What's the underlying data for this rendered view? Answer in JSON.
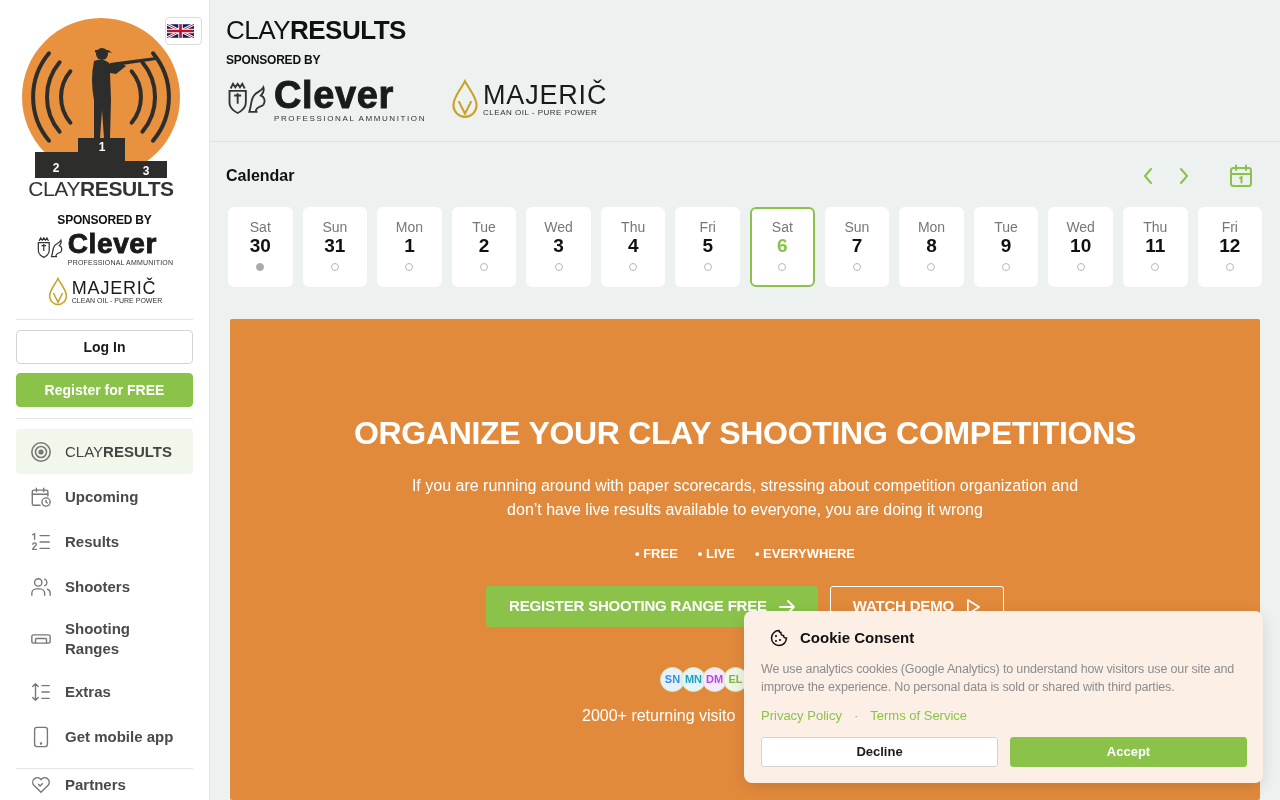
{
  "sidebar": {
    "logo": {
      "podium": [
        "2",
        "1",
        "3"
      ],
      "wordmark": "CLAY**RESULTS**"
    },
    "sponsored_label": "SPONSORED BY",
    "sponsors": [
      {
        "name": "Clever",
        "tagline": "PROFESSIONAL AMMUNITION"
      },
      {
        "name": "MAJERIČ",
        "tagline": "CLEAN OIL - PURE POWER"
      }
    ],
    "buttons": [
      {
        "label": "Log In",
        "kind": "outline"
      },
      {
        "label": "Register for FREE",
        "kind": "primary"
      }
    ],
    "nav": [
      {
        "label": "CLAY**RESULTS**",
        "kind": "brand",
        "selected": true
      },
      {
        "label": "Upcoming",
        "kind": "link",
        "selected": false
      },
      {
        "label": "Results",
        "kind": "link",
        "selected": false
      },
      {
        "label": "Shooters",
        "kind": "link",
        "selected": false
      },
      {
        "label": "Shooting Ranges",
        "kind": "link",
        "selected": false
      },
      {
        "label": "Extras",
        "kind": "link",
        "selected": false
      },
      {
        "label": "Get mobile app",
        "kind": "link",
        "selected": false
      }
    ],
    "secondary_nav": [
      {
        "label": "Partners",
        "selected": false
      }
    ]
  },
  "header": {
    "wordmark": "CLAY**RESULTS**",
    "sponsored_label": "SPONSORED BY",
    "sponsors": [
      {
        "name": "Clever",
        "tagline": "PROFESSIONAL AMMUNITION"
      },
      {
        "name": "MAJERIČ",
        "tagline": "CLEAN OIL - PURE POWER"
      }
    ]
  },
  "calendar": {
    "title": "Calendar",
    "days": [
      {
        "weekday": "Sat",
        "day": "30",
        "has_events": true,
        "selected": false
      },
      {
        "weekday": "Sun",
        "day": "31",
        "has_events": false,
        "selected": false
      },
      {
        "weekday": "Mon",
        "day": "1",
        "has_events": false,
        "selected": false
      },
      {
        "weekday": "Tue",
        "day": "2",
        "has_events": false,
        "selected": false
      },
      {
        "weekday": "Wed",
        "day": "3",
        "has_events": false,
        "selected": false
      },
      {
        "weekday": "Thu",
        "day": "4",
        "has_events": false,
        "selected": false
      },
      {
        "weekday": "Fri",
        "day": "5",
        "has_events": false,
        "selected": false
      },
      {
        "weekday": "Sat",
        "day": "6",
        "has_events": false,
        "selected": true
      },
      {
        "weekday": "Sun",
        "day": "7",
        "has_events": false,
        "selected": false
      },
      {
        "weekday": "Mon",
        "day": "8",
        "has_events": false,
        "selected": false
      },
      {
        "weekday": "Tue",
        "day": "9",
        "has_events": false,
        "selected": false
      },
      {
        "weekday": "Wed",
        "day": "10",
        "has_events": false,
        "selected": false
      },
      {
        "weekday": "Thu",
        "day": "11",
        "has_events": false,
        "selected": false
      },
      {
        "weekday": "Fri",
        "day": "12",
        "has_events": false,
        "selected": false
      }
    ]
  },
  "hero": {
    "title": "ORGANIZE YOUR CLAY SHOOTING COMPETITIONS",
    "text": "If you are running around with paper scorecards, stressing about competition organization and don’t have live results available to everyone, you are doing it wrong",
    "features": [
      "• FREE",
      "• LIVE",
      "• EVERYWHERE"
    ],
    "buttons": [
      {
        "label": "REGISTER SHOOTING RANGE FREE",
        "kind": "primary"
      },
      {
        "label": "WATCH DEMO",
        "kind": "outline"
      }
    ],
    "avatars": [
      {
        "initials": "SN",
        "color": "#3a8ee0"
      },
      {
        "initials": "MN",
        "color": "#1fa2c0"
      },
      {
        "initials": "DM",
        "color": "#b349e0"
      },
      {
        "initials": "EL",
        "color": "#7fb83f"
      }
    ],
    "stats": "2000+ returning visito"
  },
  "cookie_consent": {
    "title": "Cookie Consent",
    "text": "We use analytics cookies (Google Analytics) to understand how visitors use our site and improve the experience. No personal data is sold or shared with third parties.",
    "links": [
      "Privacy Policy",
      "Terms of Service"
    ],
    "separator": "·",
    "buttons": [
      {
        "label": "Decline",
        "kind": "outline"
      },
      {
        "label": "Accept",
        "kind": "primary"
      }
    ]
  }
}
